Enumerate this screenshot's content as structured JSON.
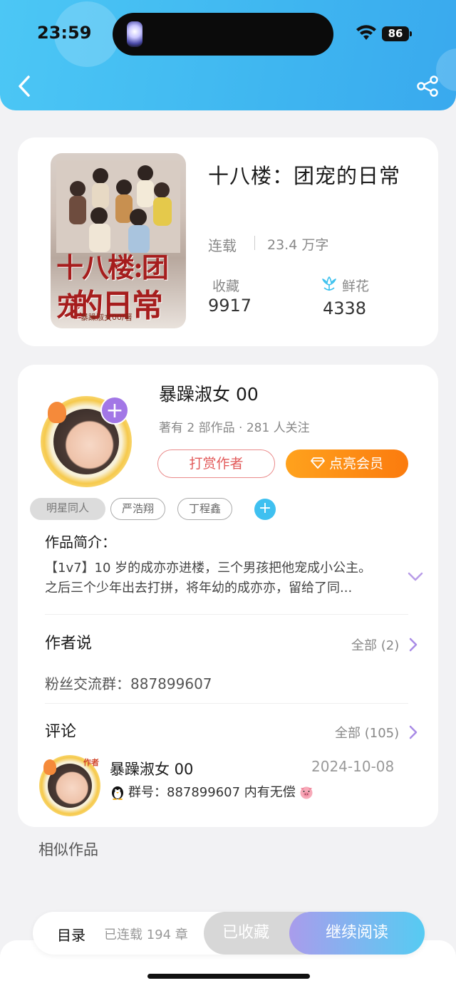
{
  "status_bar": {
    "time": "23:59",
    "battery": "86"
  },
  "book": {
    "title": "十八楼：团宠的日常",
    "status": "连载",
    "word_count": "23.4 万字",
    "favorites_label": "收藏",
    "favorites_value": "9917",
    "flowers_label": "鲜花",
    "flowers_value": "4338",
    "cover_title_line1": "十八楼:团宠",
    "cover_title_line2": "的日常",
    "cover_author": "暴躁淑女00/著"
  },
  "author": {
    "name": "暴躁淑女 00",
    "meta": "著有 2 部作品 · 281 人关注",
    "tip_label": "打赏作者",
    "vip_label": "点亮会员",
    "follow_symbol": "+"
  },
  "tags": [
    "明星同人",
    "严浩翔",
    "丁程鑫"
  ],
  "tag_add_symbol": "+",
  "intro": {
    "heading": "作品简介：",
    "line1": "【1v7】10 岁的成亦亦进楼，三个男孩把他宠成小公主。",
    "line2": "之后三个少年出去打拼，将年幼的成亦亦，留给了同..."
  },
  "author_says": {
    "heading": "作者说",
    "all_label": "全部 (2)",
    "text": "粉丝交流群：887899607"
  },
  "comments": {
    "heading": "评论",
    "all_label": "全部 (105)",
    "items": [
      {
        "badge": "作者",
        "name": "暴躁淑女 00",
        "date": "2024-10-08",
        "text": "群号：887899607  内有无偿"
      }
    ]
  },
  "similar_heading": "相似作品",
  "bottom_bar": {
    "toc_label": "目录",
    "chapter_count": "已连载 194 章",
    "saved_label": "已收藏",
    "read_label": "继续阅读"
  },
  "colors": {
    "header_gradient_start": "#4cc7f5",
    "header_gradient_end": "#39a9ee",
    "accent_purple": "#a277e6",
    "vip_orange": "#fb7b0e",
    "tip_red": "#e25a5a"
  }
}
